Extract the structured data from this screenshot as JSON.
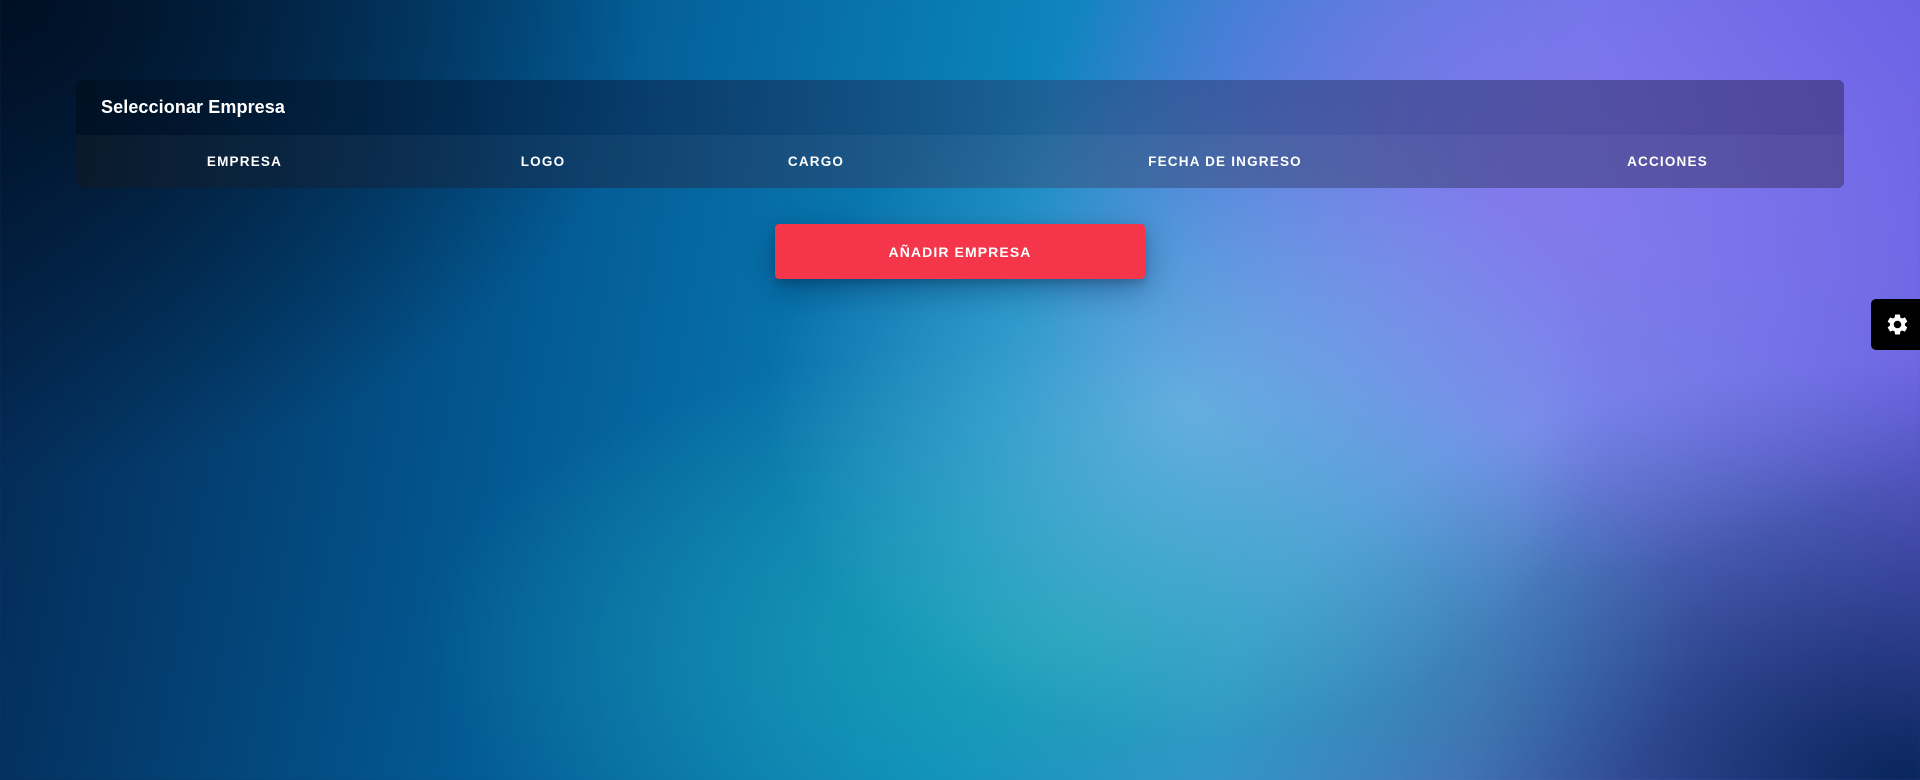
{
  "panel": {
    "title": "Seleccionar Empresa",
    "columns": [
      "EMPRESA",
      "LOGO",
      "CARGO",
      "FECHA DE INGRESO",
      "ACCIONES"
    ]
  },
  "actions": {
    "add_company_label": "AÑADIR EMPRESA"
  },
  "floating": {
    "settings_icon": "gear-icon"
  },
  "colors": {
    "accent_button": "#f5364a",
    "settings_button_bg": "#000000"
  }
}
